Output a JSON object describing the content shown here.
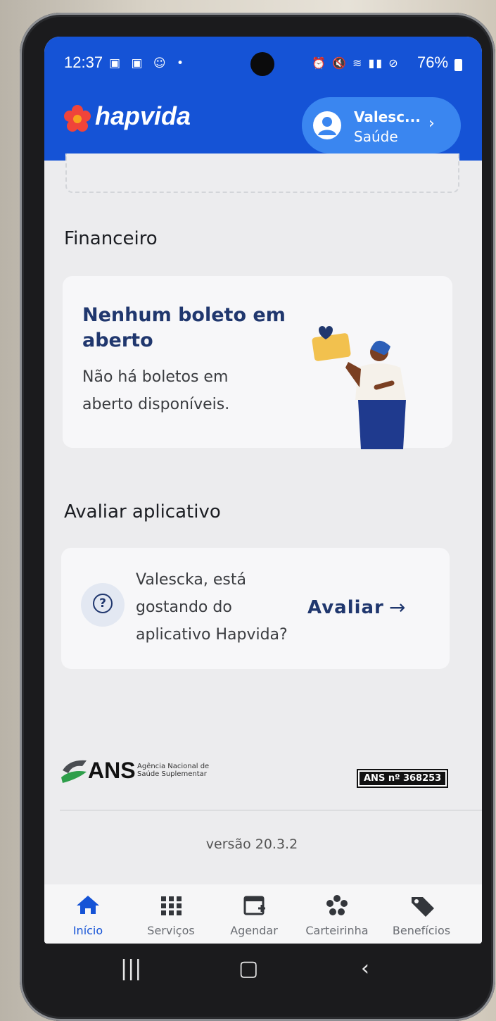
{
  "status_bar": {
    "time": "12:37",
    "battery": "76%"
  },
  "header": {
    "brand": "hapvida",
    "profile_name": "Valesc...",
    "profile_plan": "Saúde"
  },
  "financeiro": {
    "section_title": "Financeiro",
    "card_title": "Nenhum boleto em aberto",
    "card_description": "Não há boletos em aberto disponíveis."
  },
  "avaliar": {
    "section_title": "Avaliar aplicativo",
    "question": "Valescka, está gostando do aplicativo Hapvida?",
    "link_label": "Avaliar"
  },
  "footer": {
    "ans_abbr": "ANS",
    "ans_full": "Agência Nacional de Saúde Suplementar",
    "ans_registration": "ANS nº 368253",
    "version": "versão 20.3.2"
  },
  "bottom_nav": {
    "items": [
      {
        "label": "Início",
        "icon": "home-icon",
        "active": true
      },
      {
        "label": "Serviços",
        "icon": "grid-icon",
        "active": false
      },
      {
        "label": "Agendar",
        "icon": "calendar-add-icon",
        "active": false
      },
      {
        "label": "Carteirinha",
        "icon": "card-flower-icon",
        "active": false
      },
      {
        "label": "Benefícios",
        "icon": "tag-icon",
        "active": false
      }
    ]
  },
  "colors": {
    "brand_blue": "#1553d6",
    "profile_pill": "#3a86f0",
    "heading_navy": "#20376e",
    "logo_red": "#f0443a"
  }
}
